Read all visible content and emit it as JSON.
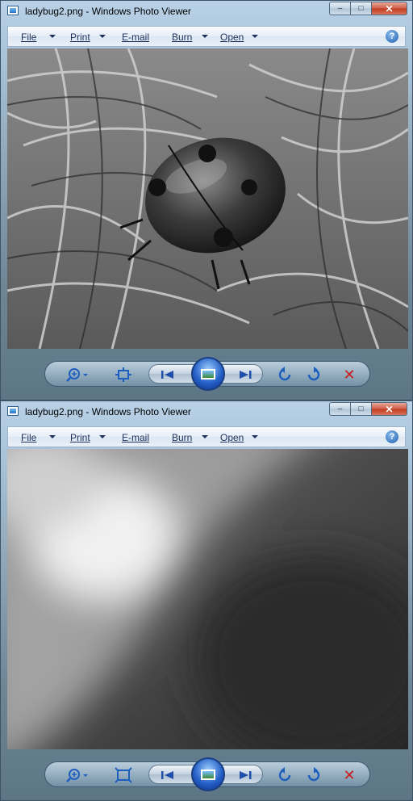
{
  "windows": [
    {
      "title": "ladybug2.png - Windows Photo Viewer",
      "menu": [
        {
          "label": "File",
          "has_arrow": true
        },
        {
          "label": "Print",
          "has_arrow": true
        },
        {
          "label": "E-mail",
          "has_arrow": false
        },
        {
          "label": "Burn",
          "has_arrow": true
        },
        {
          "label": "Open",
          "has_arrow": true
        }
      ],
      "image_description": "ladybug on grass (grayscale)",
      "fit_to_window": false
    },
    {
      "title": "ladybug2.png - Windows Photo Viewer",
      "menu": [
        {
          "label": "File",
          "has_arrow": true
        },
        {
          "label": "Print",
          "has_arrow": true
        },
        {
          "label": "E-mail",
          "has_arrow": false
        },
        {
          "label": "Burn",
          "has_arrow": true
        },
        {
          "label": "Open",
          "has_arrow": true
        }
      ],
      "image_description": "zoomed-in blurred grayscale detail",
      "fit_to_window": true
    }
  ],
  "icons": {
    "help": "?",
    "minimize": "–",
    "maximize": "□",
    "close": "✕",
    "zoom": "zoom-icon",
    "previous": "previous-icon",
    "next": "next-icon",
    "rotate_ccw": "rotate-counterclockwise-icon",
    "rotate_cw": "rotate-clockwise-icon",
    "delete": "delete-icon"
  },
  "colors": {
    "menu_text": "#1e2f5c",
    "accent_blue": "#1d5fbf",
    "delete_red": "#cc1a1a"
  }
}
